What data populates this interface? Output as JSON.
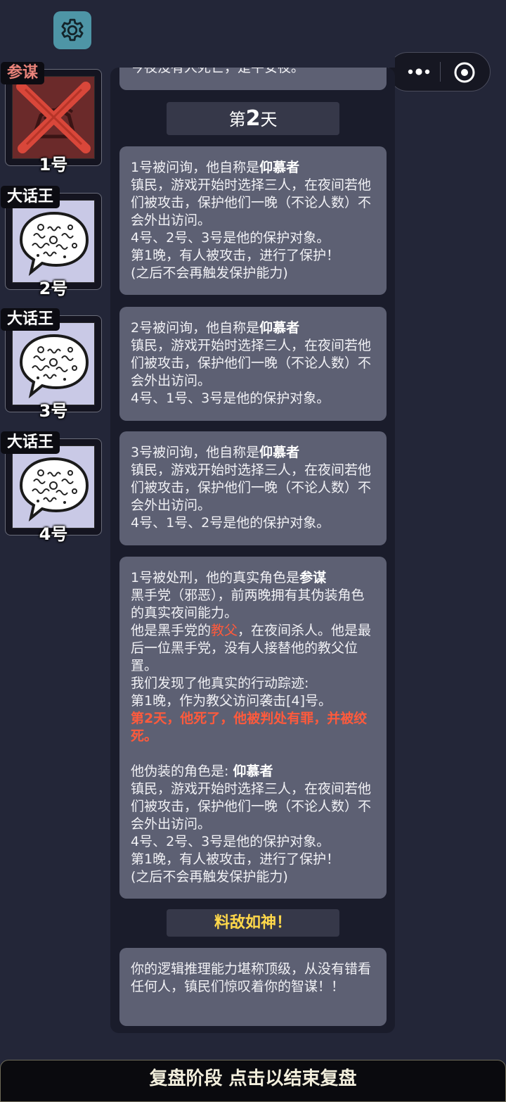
{
  "header": {
    "settings_icon": "gear-icon",
    "capsule": {
      "more_icon": "more-dots-icon",
      "close_icon": "target-close-icon"
    }
  },
  "players": [
    {
      "role": "参谋",
      "number": "1号",
      "dead": true,
      "portrait_icon": "crossed-out-portrait-icon"
    },
    {
      "role": "大话王",
      "number": "2号",
      "dead": false,
      "portrait_icon": "speech-bubble-squiggle-icon"
    },
    {
      "role": "大话王",
      "number": "3号",
      "dead": false,
      "portrait_icon": "speech-bubble-squiggle-icon"
    },
    {
      "role": "大话王",
      "number": "4号",
      "dead": false,
      "portrait_icon": "speech-bubble-squiggle-icon"
    }
  ],
  "log": {
    "top_partial": "今夜没有人死亡，是平安夜。",
    "day_header": {
      "prefix": "第",
      "day": "2",
      "suffix": "天"
    },
    "messages": [
      {
        "intro": "1号被问询，他自称是",
        "claim": "仰慕者",
        "body": "镇民，游戏开始时选择三人，在夜间若他们被攻击，保护他们一晚（不论人数）不会外出访问。\n4号、2号、3号是他的保护对象。\n第1晚，有人被攻击，进行了保护！\n(之后不会再触发保护能力)"
      },
      {
        "intro": "2号被问询，他自称是",
        "claim": "仰慕者",
        "body": "镇民，游戏开始时选择三人，在夜间若他们被攻击，保护他们一晚（不论人数）不会外出访问。\n4号、1号、3号是他的保护对象。"
      },
      {
        "intro": "3号被问询，他自称是",
        "claim": "仰慕者",
        "body": "镇民，游戏开始时选择三人，在夜间若他们被攻击，保护他们一晚（不论人数）不会外出访问。\n4号、1号、2号是他的保护对象。"
      }
    ],
    "execution": {
      "intro": "1号被处刑，他的真实角色是",
      "role": "参谋",
      "role_desc": "黑手党（邪恶），前两晚拥有其伪装角色的真实夜间能力。",
      "godfather_pre": "他是黑手党的",
      "godfather_word": "教父",
      "godfather_post": "，在夜间杀人。他是最后一位黑手党，没有人接替他的教父位置。",
      "trace": "我们发现了他真实的行动踪迹:\n第1晚，作为教父访问袭击[4]号。",
      "death": "第2天，他死了，他被判处有罪，并被绞死。",
      "disguise_label": "他伪装的角色是: ",
      "disguise_role": "仰慕者",
      "disguise_body": "镇民，游戏开始时选择三人，在夜间若他们被攻击，保护他们一晚（不论人数）不会外出访问。\n4号、2号、3号是他的保护对象。\n第1晚，有人被攻击，进行了保护！\n(之后不会再触发保护能力)"
    },
    "verdict_header": "料敌如神！",
    "verdict_text": "你的逻辑推理能力堪称顶级，从没有错看任何人，镇民们惊叹着你的智谋！！"
  },
  "footer": {
    "label": "复盘阶段 点击以结束复盘"
  },
  "colors": {
    "background": "#232638",
    "card": "#5d6073",
    "highlight_red": "#ff5a3c",
    "gold": "#ffd84a",
    "settings": "#4e95a6"
  }
}
